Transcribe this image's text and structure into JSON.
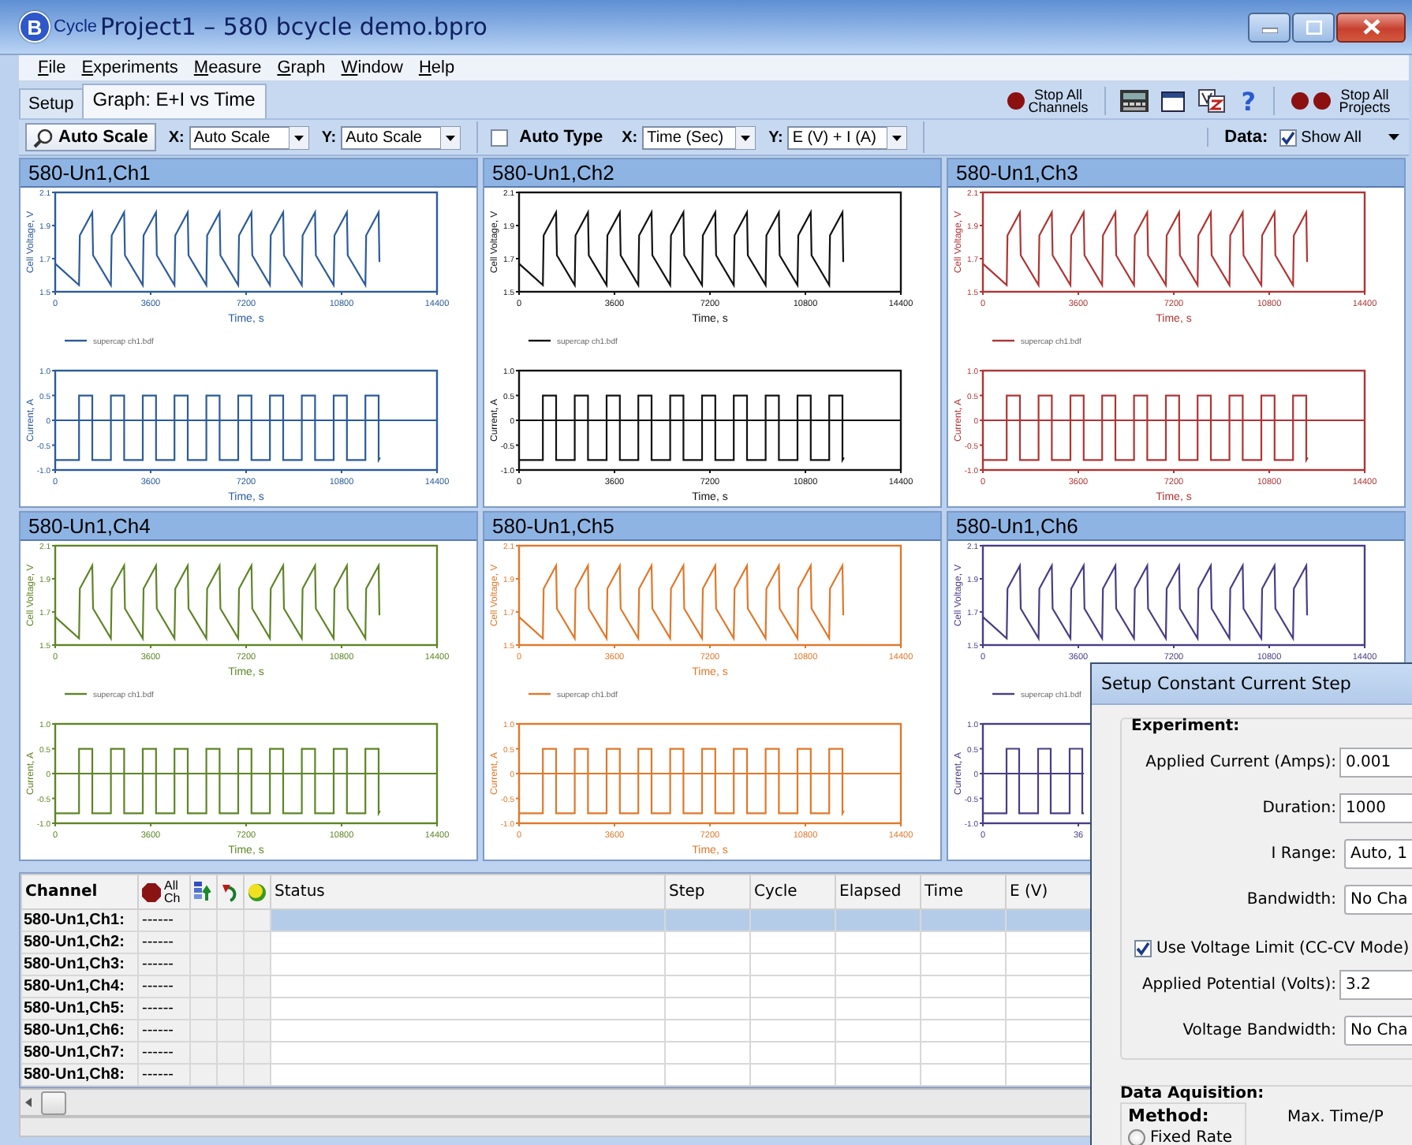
{
  "window": {
    "logo_letter": "B",
    "app_name": "Cycle",
    "title": "Project1 – 580 bcycle demo.bpro"
  },
  "menu": [
    "File",
    "Experiments",
    "Measure",
    "Graph",
    "Window",
    "Help"
  ],
  "tabs": [
    {
      "label": "Setup",
      "selected": false
    },
    {
      "label": "Graph: E+I vs Time",
      "selected": true
    }
  ],
  "toolbar": [
    {
      "kind": "stop_channels",
      "label": "Stop All Channels"
    },
    {
      "kind": "meter"
    },
    {
      "kind": "window"
    },
    {
      "kind": "sort"
    },
    {
      "kind": "help",
      "label": "?"
    },
    {
      "kind": "stop_projects",
      "label": "Stop All Projects"
    }
  ],
  "graph_toolbar": {
    "auto_scale": "Auto Scale",
    "x_label": "X:",
    "x_value": "Auto Scale",
    "y_label": "Y:",
    "y_value": "Auto Scale",
    "auto_type": {
      "label": "Auto Type",
      "checked": false
    },
    "x2_label": "X:",
    "x2_value": "Time (Sec)",
    "y2_label": "Y:",
    "y2_value": "E (V) + I (A)",
    "data_label": "Data:",
    "show_all": {
      "label": "Show All",
      "checked": true
    }
  },
  "panels": [
    {
      "title": "580-Un1,Ch1",
      "voltage_chart": {
        "chart_data": {
          "type": "line",
          "xlabel": "Time, s",
          "ylabel": "Cell Voltage, V",
          "xlim": [
            0,
            14400
          ],
          "ylim": [
            1.5,
            2.1
          ],
          "xticks": [
            0,
            3600,
            7200,
            10800,
            14400
          ],
          "yticks": [
            1.5,
            1.7,
            1.9,
            2.1
          ],
          "x": [
            0,
            900,
            930,
            1400,
            1430,
            2100,
            2130,
            2600,
            2630,
            3300,
            3330,
            3800,
            3830,
            4500,
            4530,
            5000,
            5030,
            5700,
            5730,
            6200,
            6230,
            6900,
            6930,
            7400,
            7430,
            8100,
            8130,
            8600,
            8630,
            9300,
            9330,
            9800,
            9830,
            10500,
            10530,
            11000,
            11030,
            11700,
            11730,
            12200,
            12230
          ],
          "series": [
            {
              "name": "supercap ch1.bdf",
              "color": "#2b5b9b",
              "values": [
                1.67,
                1.54,
                1.84,
                1.98,
                1.72,
                1.54,
                1.84,
                1.98,
                1.72,
                1.54,
                1.84,
                1.98,
                1.72,
                1.54,
                1.84,
                1.98,
                1.72,
                1.54,
                1.84,
                1.98,
                1.72,
                1.54,
                1.84,
                1.98,
                1.72,
                1.54,
                1.84,
                1.98,
                1.72,
                1.54,
                1.84,
                1.98,
                1.72,
                1.54,
                1.84,
                1.98,
                1.72,
                1.54,
                1.84,
                1.98,
                1.68
              ]
            }
          ]
        }
      },
      "current_chart": {
        "chart_data": {
          "type": "line",
          "xlabel": "Time, s",
          "ylabel": "Current, A",
          "xlim": [
            0,
            14400
          ],
          "ylim": [
            -1,
            1
          ],
          "xticks": [
            0,
            3600,
            7200,
            10800,
            14400
          ],
          "yticks": [
            {
              "value": -1,
              "label": "-1.0"
            },
            {
              "value": -0.5,
              "label": "-0.5"
            },
            {
              "value": 0,
              "label": "0"
            },
            {
              "value": 0.5,
              "label": "0.5"
            },
            {
              "value": 1,
              "label": "1.0"
            }
          ],
          "x": [
            0,
            900,
            900,
            1400,
            1400,
            2100,
            2100,
            2600,
            2600,
            3300,
            3300,
            3800,
            3800,
            4500,
            4500,
            5000,
            5000,
            5700,
            5700,
            6200,
            6200,
            6900,
            6900,
            7400,
            7400,
            8100,
            8100,
            8600,
            8600,
            9300,
            9300,
            9800,
            9800,
            10500,
            10500,
            11000,
            11000,
            11700,
            11700,
            12200,
            12200,
            12250
          ],
          "ref_lines": [
            {
              "axis": "y",
              "value": 0
            }
          ],
          "series": [
            {
              "color": "#2b5b9b",
              "values": [
                -0.8,
                -0.8,
                0.5,
                0.5,
                -0.8,
                -0.8,
                0.5,
                0.5,
                -0.8,
                -0.8,
                0.5,
                0.5,
                -0.8,
                -0.8,
                0.5,
                0.5,
                -0.8,
                -0.8,
                0.5,
                0.5,
                -0.8,
                -0.8,
                0.5,
                0.5,
                -0.8,
                -0.8,
                0.5,
                0.5,
                -0.8,
                -0.8,
                0.5,
                0.5,
                -0.8,
                -0.8,
                0.5,
                0.5,
                -0.8,
                -0.8,
                0.5,
                0.5,
                -0.8,
                -0.75
              ]
            }
          ]
        }
      }
    },
    {
      "title": "580-Un1,Ch2",
      "voltage_chart": {
        "chart_data": {
          "type": "line",
          "xlabel": "Time, s",
          "ylabel": "Cell Voltage, V",
          "xlim": [
            0,
            14400
          ],
          "ylim": [
            1.5,
            2.1
          ],
          "xticks": [
            0,
            3600,
            7200,
            10800,
            14400
          ],
          "yticks": [
            1.5,
            1.7,
            1.9,
            2.1
          ],
          "x": [
            0,
            900,
            930,
            1400,
            1430,
            2100,
            2130,
            2600,
            2630,
            3300,
            3330,
            3800,
            3830,
            4500,
            4530,
            5000,
            5030,
            5700,
            5730,
            6200,
            6230,
            6900,
            6930,
            7400,
            7430,
            8100,
            8130,
            8600,
            8630,
            9300,
            9330,
            9800,
            9830,
            10500,
            10530,
            11000,
            11030,
            11700,
            11730,
            12200,
            12230
          ],
          "series": [
            {
              "name": "supercap ch1.bdf",
              "color": "#111111",
              "values": [
                1.67,
                1.54,
                1.84,
                1.98,
                1.72,
                1.54,
                1.84,
                1.98,
                1.72,
                1.54,
                1.84,
                1.98,
                1.72,
                1.54,
                1.84,
                1.98,
                1.72,
                1.54,
                1.84,
                1.98,
                1.72,
                1.54,
                1.84,
                1.98,
                1.72,
                1.54,
                1.84,
                1.98,
                1.72,
                1.54,
                1.84,
                1.98,
                1.72,
                1.54,
                1.84,
                1.98,
                1.72,
                1.54,
                1.84,
                1.98,
                1.68
              ]
            }
          ]
        }
      },
      "current_chart": {
        "chart_data": {
          "type": "line",
          "xlabel": "Time, s",
          "ylabel": "Current, A",
          "xlim": [
            0,
            14400
          ],
          "ylim": [
            -1,
            1
          ],
          "xticks": [
            0,
            3600,
            7200,
            10800,
            14400
          ],
          "yticks": [
            {
              "value": -1,
              "label": "-1.0"
            },
            {
              "value": -0.5,
              "label": "-0.5"
            },
            {
              "value": 0,
              "label": "0"
            },
            {
              "value": 0.5,
              "label": "0.5"
            },
            {
              "value": 1,
              "label": "1.0"
            }
          ],
          "x": [
            0,
            900,
            900,
            1400,
            1400,
            2100,
            2100,
            2600,
            2600,
            3300,
            3300,
            3800,
            3800,
            4500,
            4500,
            5000,
            5000,
            5700,
            5700,
            6200,
            6200,
            6900,
            6900,
            7400,
            7400,
            8100,
            8100,
            8600,
            8600,
            9300,
            9300,
            9800,
            9800,
            10500,
            10500,
            11000,
            11000,
            11700,
            11700,
            12200,
            12200,
            12250
          ],
          "ref_lines": [
            {
              "axis": "y",
              "value": 0
            }
          ],
          "series": [
            {
              "color": "#111111",
              "values": [
                -0.8,
                -0.8,
                0.5,
                0.5,
                -0.8,
                -0.8,
                0.5,
                0.5,
                -0.8,
                -0.8,
                0.5,
                0.5,
                -0.8,
                -0.8,
                0.5,
                0.5,
                -0.8,
                -0.8,
                0.5,
                0.5,
                -0.8,
                -0.8,
                0.5,
                0.5,
                -0.8,
                -0.8,
                0.5,
                0.5,
                -0.8,
                -0.8,
                0.5,
                0.5,
                -0.8,
                -0.8,
                0.5,
                0.5,
                -0.8,
                -0.8,
                0.5,
                0.5,
                -0.8,
                -0.75
              ]
            }
          ]
        }
      }
    },
    {
      "title": "580-Un1,Ch3",
      "voltage_chart": {
        "chart_data": {
          "type": "line",
          "xlabel": "Time, s",
          "ylabel": "Cell Voltage, V",
          "xlim": [
            0,
            14400
          ],
          "ylim": [
            1.5,
            2.1
          ],
          "xticks": [
            0,
            3600,
            7200,
            10800,
            14400
          ],
          "yticks": [
            1.5,
            1.7,
            1.9,
            2.1
          ],
          "x": [
            0,
            900,
            930,
            1400,
            1430,
            2100,
            2130,
            2600,
            2630,
            3300,
            3330,
            3800,
            3830,
            4500,
            4530,
            5000,
            5030,
            5700,
            5730,
            6200,
            6230,
            6900,
            6930,
            7400,
            7430,
            8100,
            8130,
            8600,
            8630,
            9300,
            9330,
            9800,
            9830,
            10500,
            10530,
            11000,
            11030,
            11700,
            11730,
            12200,
            12230
          ],
          "series": [
            {
              "name": "supercap ch1.bdf",
              "color": "#b03434",
              "values": [
                1.67,
                1.54,
                1.84,
                1.98,
                1.72,
                1.54,
                1.84,
                1.98,
                1.72,
                1.54,
                1.84,
                1.98,
                1.72,
                1.54,
                1.84,
                1.98,
                1.72,
                1.54,
                1.84,
                1.98,
                1.72,
                1.54,
                1.84,
                1.98,
                1.72,
                1.54,
                1.84,
                1.98,
                1.72,
                1.54,
                1.84,
                1.98,
                1.72,
                1.54,
                1.84,
                1.98,
                1.72,
                1.54,
                1.84,
                1.98,
                1.68
              ]
            }
          ]
        }
      },
      "current_chart": {
        "chart_data": {
          "type": "line",
          "xlabel": "Time, s",
          "ylabel": "Current, A",
          "xlim": [
            0,
            14400
          ],
          "ylim": [
            -1,
            1
          ],
          "xticks": [
            0,
            3600,
            7200,
            10800,
            14400
          ],
          "yticks": [
            {
              "value": -1,
              "label": "-1.0"
            },
            {
              "value": -0.5,
              "label": "-0.5"
            },
            {
              "value": 0,
              "label": "0"
            },
            {
              "value": 0.5,
              "label": "0.5"
            },
            {
              "value": 1,
              "label": "1.0"
            }
          ],
          "x": [
            0,
            900,
            900,
            1400,
            1400,
            2100,
            2100,
            2600,
            2600,
            3300,
            3300,
            3800,
            3800,
            4500,
            4500,
            5000,
            5000,
            5700,
            5700,
            6200,
            6200,
            6900,
            6900,
            7400,
            7400,
            8100,
            8100,
            8600,
            8600,
            9300,
            9300,
            9800,
            9800,
            10500,
            10500,
            11000,
            11000,
            11700,
            11700,
            12200,
            12200,
            12250
          ],
          "ref_lines": [
            {
              "axis": "y",
              "value": 0
            }
          ],
          "series": [
            {
              "color": "#b03434",
              "values": [
                -0.8,
                -0.8,
                0.5,
                0.5,
                -0.8,
                -0.8,
                0.5,
                0.5,
                -0.8,
                -0.8,
                0.5,
                0.5,
                -0.8,
                -0.8,
                0.5,
                0.5,
                -0.8,
                -0.8,
                0.5,
                0.5,
                -0.8,
                -0.8,
                0.5,
                0.5,
                -0.8,
                -0.8,
                0.5,
                0.5,
                -0.8,
                -0.8,
                0.5,
                0.5,
                -0.8,
                -0.8,
                0.5,
                0.5,
                -0.8,
                -0.8,
                0.5,
                0.5,
                -0.8,
                -0.75
              ]
            }
          ]
        }
      }
    },
    {
      "title": "580-Un1,Ch4",
      "voltage_chart": {
        "chart_data": {
          "type": "line",
          "xlabel": "Time, s",
          "ylabel": "Cell Voltage, V",
          "xlim": [
            0,
            14400
          ],
          "ylim": [
            1.5,
            2.1
          ],
          "xticks": [
            0,
            3600,
            7200,
            10800,
            14400
          ],
          "yticks": [
            1.5,
            1.7,
            1.9,
            2.1
          ],
          "x": [
            0,
            900,
            930,
            1400,
            1430,
            2100,
            2130,
            2600,
            2630,
            3300,
            3330,
            3800,
            3830,
            4500,
            4530,
            5000,
            5030,
            5700,
            5730,
            6200,
            6230,
            6900,
            6930,
            7400,
            7430,
            8100,
            8130,
            8600,
            8630,
            9300,
            9330,
            9800,
            9830,
            10500,
            10530,
            11000,
            11030,
            11700,
            11730,
            12200,
            12230
          ],
          "series": [
            {
              "name": "supercap ch1.bdf",
              "color": "#5e8526",
              "values": [
                1.67,
                1.54,
                1.84,
                1.98,
                1.72,
                1.54,
                1.84,
                1.98,
                1.72,
                1.54,
                1.84,
                1.98,
                1.72,
                1.54,
                1.84,
                1.98,
                1.72,
                1.54,
                1.84,
                1.98,
                1.72,
                1.54,
                1.84,
                1.98,
                1.72,
                1.54,
                1.84,
                1.98,
                1.72,
                1.54,
                1.84,
                1.98,
                1.72,
                1.54,
                1.84,
                1.98,
                1.72,
                1.54,
                1.84,
                1.98,
                1.68
              ]
            }
          ]
        }
      },
      "current_chart": {
        "chart_data": {
          "type": "line",
          "xlabel": "Time, s",
          "ylabel": "Current, A",
          "xlim": [
            0,
            14400
          ],
          "ylim": [
            -1,
            1
          ],
          "xticks": [
            0,
            3600,
            7200,
            10800,
            14400
          ],
          "yticks": [
            {
              "value": -1,
              "label": "-1.0"
            },
            {
              "value": -0.5,
              "label": "-0.5"
            },
            {
              "value": 0,
              "label": "0"
            },
            {
              "value": 0.5,
              "label": "0.5"
            },
            {
              "value": 1,
              "label": "1.0"
            }
          ],
          "x": [
            0,
            900,
            900,
            1400,
            1400,
            2100,
            2100,
            2600,
            2600,
            3300,
            3300,
            3800,
            3800,
            4500,
            4500,
            5000,
            5000,
            5700,
            5700,
            6200,
            6200,
            6900,
            6900,
            7400,
            7400,
            8100,
            8100,
            8600,
            8600,
            9300,
            9300,
            9800,
            9800,
            10500,
            10500,
            11000,
            11000,
            11700,
            11700,
            12200,
            12200,
            12250
          ],
          "ref_lines": [
            {
              "axis": "y",
              "value": 0
            }
          ],
          "series": [
            {
              "color": "#5e8526",
              "values": [
                -0.8,
                -0.8,
                0.5,
                0.5,
                -0.8,
                -0.8,
                0.5,
                0.5,
                -0.8,
                -0.8,
                0.5,
                0.5,
                -0.8,
                -0.8,
                0.5,
                0.5,
                -0.8,
                -0.8,
                0.5,
                0.5,
                -0.8,
                -0.8,
                0.5,
                0.5,
                -0.8,
                -0.8,
                0.5,
                0.5,
                -0.8,
                -0.8,
                0.5,
                0.5,
                -0.8,
                -0.8,
                0.5,
                0.5,
                -0.8,
                -0.8,
                0.5,
                0.5,
                -0.8,
                -0.75
              ]
            }
          ]
        }
      }
    },
    {
      "title": "580-Un1,Ch5",
      "voltage_chart": {
        "chart_data": {
          "type": "line",
          "xlabel": "Time, s",
          "ylabel": "Cell Voltage, V",
          "xlim": [
            0,
            14400
          ],
          "ylim": [
            1.5,
            2.1
          ],
          "xticks": [
            0,
            3600,
            7200,
            10800,
            14400
          ],
          "yticks": [
            1.5,
            1.7,
            1.9,
            2.1
          ],
          "x": [
            0,
            900,
            930,
            1400,
            1430,
            2100,
            2130,
            2600,
            2630,
            3300,
            3330,
            3800,
            3830,
            4500,
            4530,
            5000,
            5030,
            5700,
            5730,
            6200,
            6230,
            6900,
            6930,
            7400,
            7430,
            8100,
            8130,
            8600,
            8630,
            9300,
            9330,
            9800,
            9830,
            10500,
            10530,
            11000,
            11030,
            11700,
            11730,
            12200,
            12230
          ],
          "series": [
            {
              "name": "supercap ch1.bdf",
              "color": "#e0782a",
              "values": [
                1.67,
                1.54,
                1.84,
                1.98,
                1.72,
                1.54,
                1.84,
                1.98,
                1.72,
                1.54,
                1.84,
                1.98,
                1.72,
                1.54,
                1.84,
                1.98,
                1.72,
                1.54,
                1.84,
                1.98,
                1.72,
                1.54,
                1.84,
                1.98,
                1.72,
                1.54,
                1.84,
                1.98,
                1.72,
                1.54,
                1.84,
                1.98,
                1.72,
                1.54,
                1.84,
                1.98,
                1.72,
                1.54,
                1.84,
                1.98,
                1.68
              ]
            }
          ]
        }
      },
      "current_chart": {
        "chart_data": {
          "type": "line",
          "xlabel": "Time, s",
          "ylabel": "Current, A",
          "xlim": [
            0,
            14400
          ],
          "ylim": [
            -1,
            1
          ],
          "xticks": [
            0,
            3600,
            7200,
            10800,
            14400
          ],
          "yticks": [
            {
              "value": -1,
              "label": "-1.0"
            },
            {
              "value": -0.5,
              "label": "-0.5"
            },
            {
              "value": 0,
              "label": "0"
            },
            {
              "value": 0.5,
              "label": "0.5"
            },
            {
              "value": 1,
              "label": "1.0"
            }
          ],
          "x": [
            0,
            900,
            900,
            1400,
            1400,
            2100,
            2100,
            2600,
            2600,
            3300,
            3300,
            3800,
            3800,
            4500,
            4500,
            5000,
            5000,
            5700,
            5700,
            6200,
            6200,
            6900,
            6900,
            7400,
            7400,
            8100,
            8100,
            8600,
            8600,
            9300,
            9300,
            9800,
            9800,
            10500,
            10500,
            11000,
            11000,
            11700,
            11700,
            12200,
            12200,
            12250
          ],
          "ref_lines": [
            {
              "axis": "y",
              "value": 0
            }
          ],
          "series": [
            {
              "color": "#e0782a",
              "values": [
                -0.8,
                -0.8,
                0.5,
                0.5,
                -0.8,
                -0.8,
                0.5,
                0.5,
                -0.8,
                -0.8,
                0.5,
                0.5,
                -0.8,
                -0.8,
                0.5,
                0.5,
                -0.8,
                -0.8,
                0.5,
                0.5,
                -0.8,
                -0.8,
                0.5,
                0.5,
                -0.8,
                -0.8,
                0.5,
                0.5,
                -0.8,
                -0.8,
                0.5,
                0.5,
                -0.8,
                -0.8,
                0.5,
                0.5,
                -0.8,
                -0.8,
                0.5,
                0.5,
                -0.8,
                -0.75
              ]
            }
          ]
        }
      }
    },
    {
      "title": "580-Un1,Ch6",
      "voltage_chart": {
        "chart_data": {
          "type": "line",
          "ylabel": "Cell Voltage, V",
          "xlim": [
            0,
            14400
          ],
          "ylim": [
            1.5,
            2.1
          ],
          "xticks": [
            0,
            3600,
            7200,
            10800,
            14400
          ],
          "yticks": [
            1.5,
            1.7,
            1.9,
            2.1
          ],
          "x": [
            0,
            900,
            930,
            1400,
            1430,
            2100,
            2130,
            2600,
            2630,
            3300,
            3330,
            3800,
            3830,
            4500,
            4530,
            5000,
            5030,
            5700,
            5730,
            6200,
            6230,
            6900,
            6930,
            7400,
            7430,
            8100,
            8130,
            8600,
            8630,
            9300,
            9330,
            9800,
            9830,
            10500,
            10530,
            11000,
            11030,
            11700,
            11730,
            12200,
            12230
          ],
          "series": [
            {
              "name": "supercap ch1.bdf",
              "color": "#4a3c86",
              "values": [
                1.67,
                1.54,
                1.84,
                1.98,
                1.72,
                1.54,
                1.84,
                1.98,
                1.72,
                1.54,
                1.84,
                1.98,
                1.72,
                1.54,
                1.84,
                1.98,
                1.72,
                1.54,
                1.84,
                1.98,
                1.72,
                1.54,
                1.84,
                1.98,
                1.72,
                1.54,
                1.84,
                1.98,
                1.72,
                1.54,
                1.84,
                1.98,
                1.72,
                1.54,
                1.84,
                1.98,
                1.72,
                1.54,
                1.84,
                1.98,
                1.68
              ]
            }
          ]
        }
      },
      "current_chart": {
        "kind": "partial",
        "color": "#4a3c86",
        "ylabel": "Current, A",
        "ytick_labels": [
          "1.0",
          "0.5",
          "0",
          "-0.5",
          "-1.0"
        ],
        "xtick_labels": [
          "0",
          "36"
        ]
      }
    }
  ],
  "table": {
    "columns": [
      {
        "kind": "text",
        "label": "Channel"
      },
      {
        "kind": "stop",
        "label": "All Ch"
      },
      {
        "kind": "bars"
      },
      {
        "kind": "loop"
      },
      {
        "kind": "dot"
      },
      {
        "kind": "text",
        "label": "Status"
      },
      {
        "kind": "text",
        "label": "Step"
      },
      {
        "kind": "text",
        "label": "Cycle"
      },
      {
        "kind": "text",
        "label": "Elapsed"
      },
      {
        "kind": "text",
        "label": "Time"
      },
      {
        "kind": "text",
        "label": "E (V)"
      }
    ],
    "rows": [
      {
        "channel": "580-Un1,Ch1:",
        "state": "------",
        "selected": true
      },
      {
        "channel": "580-Un1,Ch2:",
        "state": "------",
        "selected": false
      },
      {
        "channel": "580-Un1,Ch3:",
        "state": "------",
        "selected": false
      },
      {
        "channel": "580-Un1,Ch4:",
        "state": "------",
        "selected": false
      },
      {
        "channel": "580-Un1,Ch5:",
        "state": "------",
        "selected": false
      },
      {
        "channel": "580-Un1,Ch6:",
        "state": "------",
        "selected": false
      },
      {
        "channel": "580-Un1,Ch7:",
        "state": "------",
        "selected": false
      },
      {
        "channel": "580-Un1,Ch8:",
        "state": "------",
        "selected": false
      }
    ]
  },
  "dialog": {
    "title": "Setup Constant Current Step",
    "experiment": {
      "heading": "Experiment:",
      "fields": [
        {
          "label": "Applied Current (Amps):",
          "value": "0.001",
          "kind": "input"
        },
        {
          "label": "Duration:",
          "value": "1000",
          "kind": "input"
        },
        {
          "label": "I Range:",
          "value": "Auto, 1",
          "kind": "select"
        },
        {
          "label": "Bandwidth:",
          "value": "No Cha",
          "kind": "select"
        }
      ],
      "voltage_limit": {
        "label": "Use Voltage Limit (CC-CV Mode)",
        "checked": true
      },
      "limit_fields": [
        {
          "label": "Applied Potential (Volts):",
          "value": "3.2",
          "kind": "input"
        },
        {
          "label": "Voltage Bandwidth:",
          "value": "No Cha",
          "kind": "select"
        }
      ]
    },
    "acquisition": {
      "heading": "Data Aquisition:",
      "method": "Method:",
      "max_time": "Max. Time/P",
      "option": {
        "label": "Fixed Rate",
        "selected": false
      }
    }
  }
}
